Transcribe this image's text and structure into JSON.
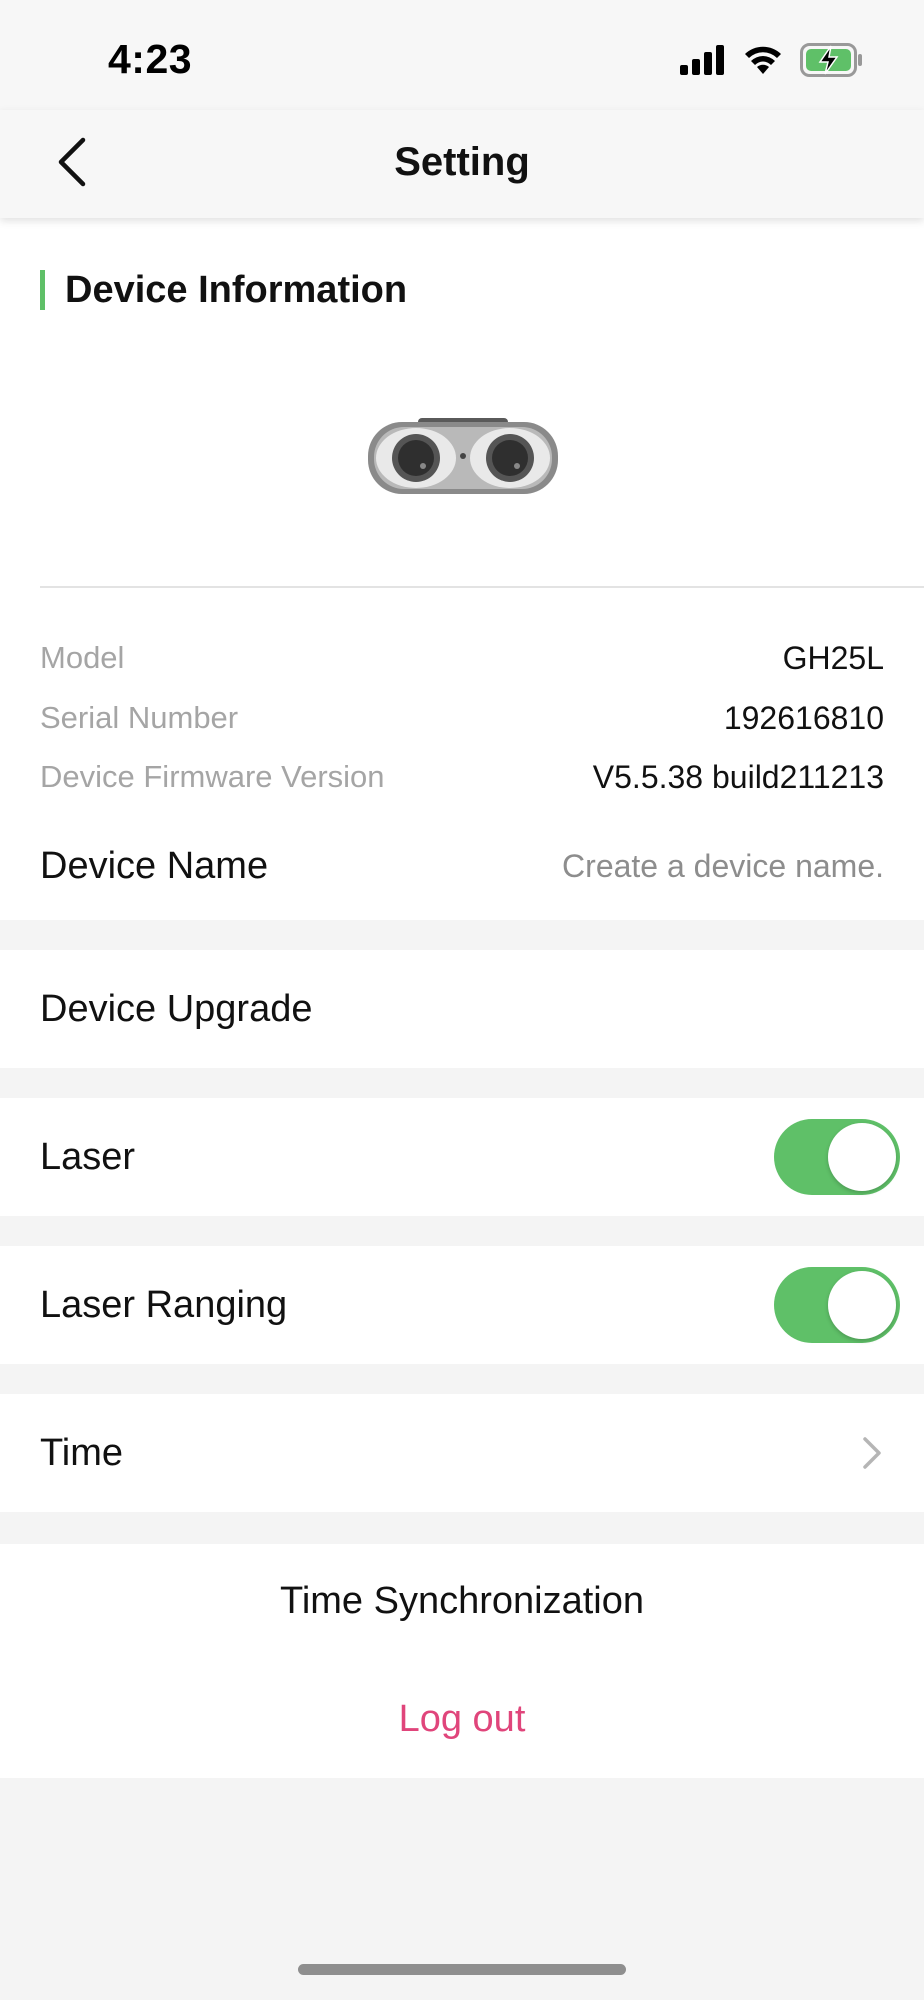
{
  "status_bar": {
    "time": "4:23",
    "icons": [
      "cellular-signal-icon",
      "wifi-icon",
      "battery-charging-icon"
    ],
    "battery_color": "#5fc068"
  },
  "nav": {
    "title": "Setting",
    "back_icon": "chevron-left-icon"
  },
  "device_info": {
    "section_title": "Device Information",
    "image": "binocular-device-image",
    "details": [
      {
        "label": "Model",
        "value": "GH25L"
      },
      {
        "label": "Serial Number",
        "value": "192616810"
      },
      {
        "label": "Device Firmware Version",
        "value": "V5.5.38 build211213"
      }
    ],
    "name_label": "Device Name",
    "name_placeholder": "Create a device name."
  },
  "rows": {
    "device_upgrade": "Device Upgrade",
    "laser": {
      "label": "Laser",
      "on": true
    },
    "laser_ranging": {
      "label": "Laser Ranging",
      "on": true
    },
    "time": {
      "label": "Time",
      "icon": "chevron-right-icon"
    }
  },
  "actions": {
    "time_sync": "Time Synchronization",
    "logout": "Log out"
  },
  "colors": {
    "accent": "#5fc068",
    "logout": "#e0457b",
    "background": "#f4f4f4"
  }
}
